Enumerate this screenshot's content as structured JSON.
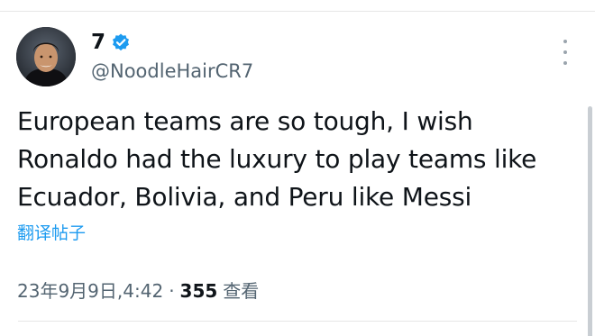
{
  "user": {
    "display_name": "7",
    "handle": "@NoodleHairCR7",
    "verified": true
  },
  "tweet": {
    "lines": [
      "European teams are so tough, I wish",
      "Ronaldo had the luxury to play teams like",
      "Ecuador, Bolivia, and Peru like Messi"
    ]
  },
  "translate_label": "翻译帖子",
  "meta": {
    "date": "23年9月9日",
    "time": "4:42",
    "separator": "·",
    "views_count": "355",
    "views_label": "查看"
  },
  "colors": {
    "accent": "#1d9bf0",
    "text_primary": "#0f1419",
    "text_secondary": "#536471",
    "divider": "#e6e6e6"
  },
  "icons": {
    "verified": "verified-badge-icon",
    "more": "more-vertical-icon"
  }
}
